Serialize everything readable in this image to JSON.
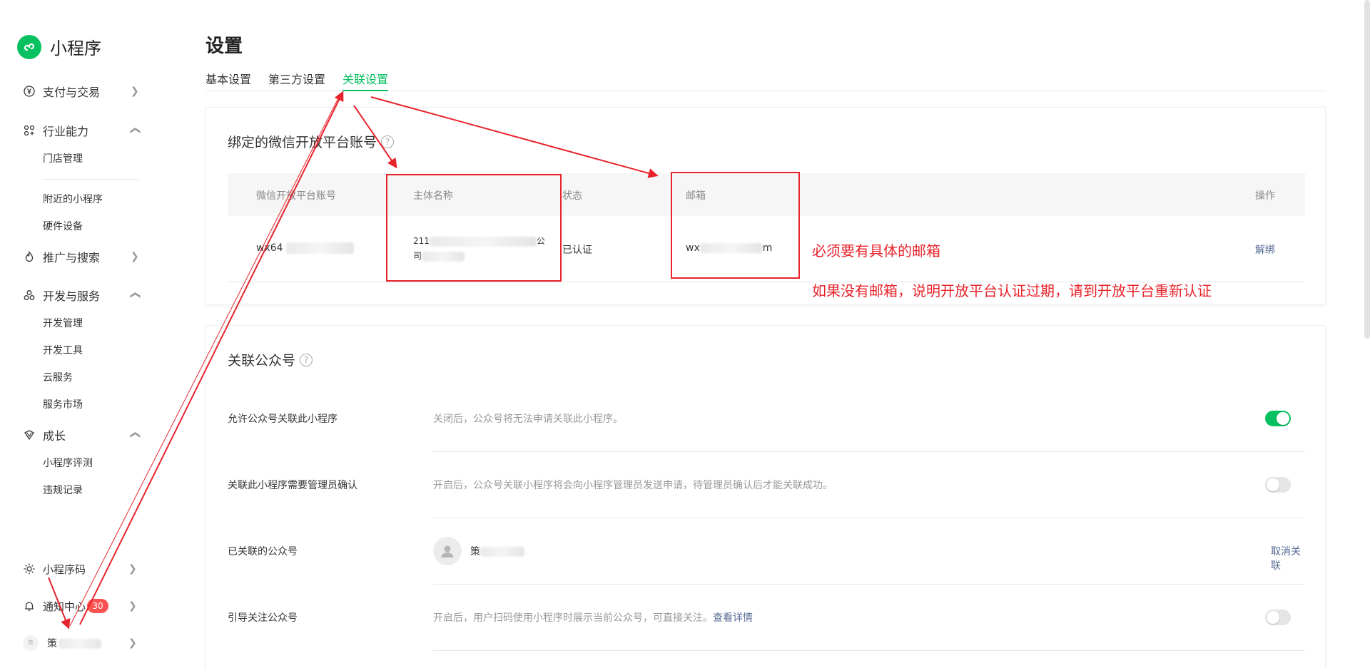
{
  "app": {
    "name": "小程序"
  },
  "sidebar": {
    "groups": [
      {
        "label": "支付与交易",
        "icon": "yen-icon"
      },
      {
        "label": "行业能力",
        "icon": "apps-icon"
      },
      {
        "label": "推广与搜索",
        "icon": "flame-icon"
      },
      {
        "label": "开发与服务",
        "icon": "dev-icon"
      },
      {
        "label": "成长",
        "icon": "growth-icon"
      }
    ],
    "industry_items": [
      "门店管理",
      "附近的小程序",
      "硬件设备"
    ],
    "dev_items": [
      "开发管理",
      "开发工具",
      "云服务",
      "服务市场"
    ],
    "growth_items": [
      "小程序评测",
      "违规记录"
    ],
    "bottom": {
      "qrcode": "小程序码",
      "notifications": "通知中心",
      "notification_count": "30",
      "account": "策",
      "avatar_text": "策"
    }
  },
  "page": {
    "title": "设置",
    "tabs": [
      "基本设置",
      "第三方设置",
      "关联设置"
    ],
    "active_tab": 2
  },
  "open_platform": {
    "title": "绑定的微信开放平台账号",
    "columns": [
      "微信开放平台账号",
      "主体名称",
      "状态",
      "邮箱",
      "操作"
    ],
    "row": {
      "account": "wx64",
      "entity_name_line1": "211",
      "entity_name_suffix": "公",
      "entity_name_line2": "司",
      "status": "已认证",
      "email_prefix": "wx",
      "email_suffix": "m",
      "action": "解绑"
    }
  },
  "official_account": {
    "title": "关联公众号",
    "rows": [
      {
        "label": "允许公众号关联此小程序",
        "desc": "关闭后，公众号将无法申请关联此小程序。",
        "toggle": "on"
      },
      {
        "label": "关联此小程序需要管理员确认",
        "desc": "开启后，公众号关联小程序将会向小程序管理员发送申请，待管理员确认后才能关联成功。",
        "toggle": "off"
      },
      {
        "label": "已关联的公众号",
        "name": "策",
        "action": "取消关联"
      },
      {
        "label": "引导关注公众号",
        "desc": "开启后，用户扫码使用小程序时展示当前公众号，可直接关注。",
        "link": "查看详情",
        "toggle": "off"
      }
    ]
  },
  "annotations": {
    "note1": "必须要有具体的邮箱",
    "note2": "如果没有邮箱，说明开放平台认证过期，请到开放平台重新认证",
    "color": "#e8232b"
  },
  "colors": {
    "accent": "#07c160",
    "link": "#576b95",
    "badge": "#fa5151"
  }
}
